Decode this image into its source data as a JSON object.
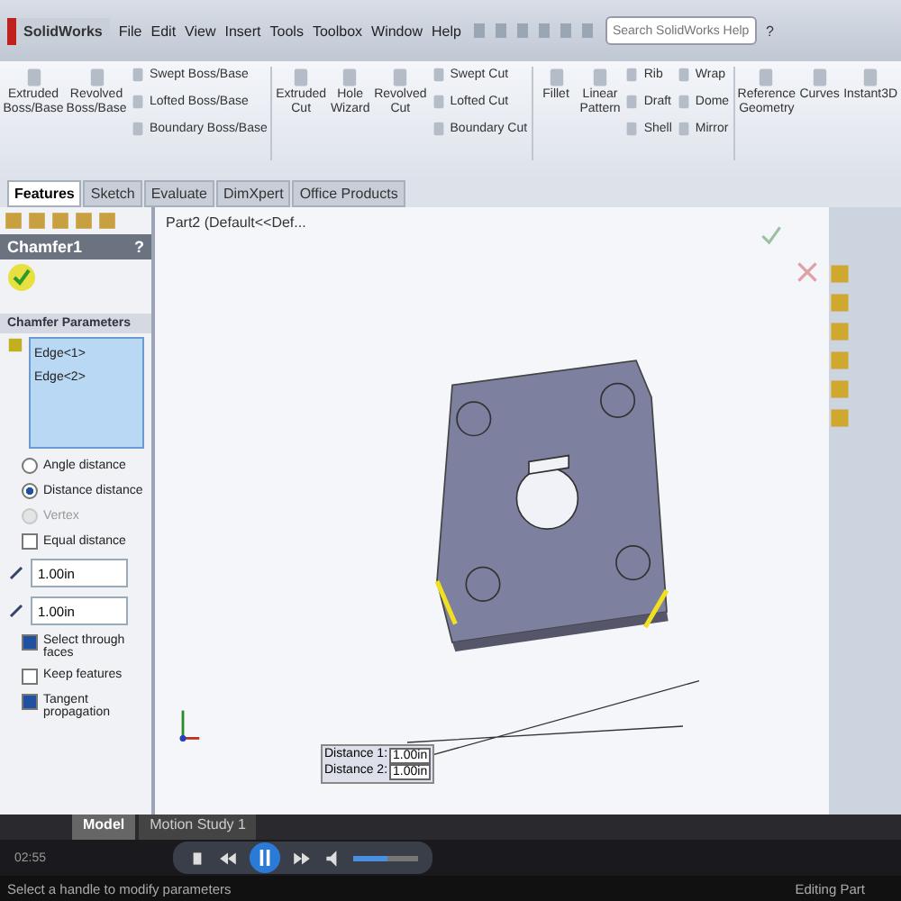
{
  "app": {
    "logo": "SolidWorks",
    "menu": [
      "File",
      "Edit",
      "View",
      "Insert",
      "Tools",
      "Toolbox",
      "Window",
      "Help"
    ],
    "search": {
      "placeholder": "Search SolidWorks Help"
    },
    "help": "?"
  },
  "ribbon": [
    {
      "kind": "large",
      "label": "Extruded Boss/Base"
    },
    {
      "kind": "large",
      "label": "Revolved Boss/Base"
    },
    {
      "kind": "stack",
      "items": [
        "Swept Boss/Base",
        "Lofted Boss/Base",
        "Boundary Boss/Base"
      ]
    },
    {
      "kind": "sep"
    },
    {
      "kind": "large",
      "label": "Extruded Cut"
    },
    {
      "kind": "large",
      "label": "Hole Wizard"
    },
    {
      "kind": "large",
      "label": "Revolved Cut"
    },
    {
      "kind": "stack",
      "items": [
        "Swept Cut",
        "Lofted Cut",
        "Boundary Cut"
      ]
    },
    {
      "kind": "sep"
    },
    {
      "kind": "large",
      "label": "Fillet"
    },
    {
      "kind": "large",
      "label": "Linear Pattern"
    },
    {
      "kind": "stack",
      "items": [
        "Rib",
        "Draft",
        "Shell"
      ]
    },
    {
      "kind": "stack",
      "items": [
        "Wrap",
        "Dome",
        "Mirror"
      ]
    },
    {
      "kind": "sep"
    },
    {
      "kind": "large",
      "label": "Reference Geometry"
    },
    {
      "kind": "large",
      "label": "Curves"
    },
    {
      "kind": "large",
      "label": "Instant3D"
    }
  ],
  "tabs": [
    {
      "label": "Features",
      "selected": true
    },
    {
      "label": "Sketch",
      "selected": false
    },
    {
      "label": "Evaluate",
      "selected": false
    },
    {
      "label": "DimXpert",
      "selected": false
    },
    {
      "label": "Office Products",
      "selected": false
    }
  ],
  "tree": {
    "label": "Part2  (Default<<Def..."
  },
  "panel": {
    "title": "Chamfer1",
    "help": "?",
    "section": "Chamfer Parameters",
    "edges": [
      "Edge<1>",
      "Edge<2>"
    ],
    "options": [
      {
        "label": "Angle distance",
        "selected": false,
        "disabled": false
      },
      {
        "label": "Distance distance",
        "selected": true,
        "disabled": false
      },
      {
        "label": "Vertex",
        "selected": false,
        "disabled": true
      }
    ],
    "equal": {
      "label": "Equal distance",
      "checked": false
    },
    "fields": [
      {
        "value": "1.00in"
      },
      {
        "value": "1.00in"
      }
    ],
    "checks": [
      {
        "label": "Select through faces",
        "checked": true
      },
      {
        "label": "Keep features",
        "checked": false
      },
      {
        "label": "Tangent propagation",
        "checked": true
      }
    ]
  },
  "callout": [
    {
      "label": "Distance 1:",
      "value": "1.00in"
    },
    {
      "label": "Distance 2:",
      "value": "1.00in"
    }
  ],
  "bottom_tabs": [
    {
      "label": "Model",
      "selected": true
    },
    {
      "label": "Motion Study 1",
      "selected": false
    }
  ],
  "player": {
    "time": "02:55",
    "level": 0.55
  },
  "status": {
    "message": "Select a handle to modify parameters",
    "mode": "Editing Part"
  }
}
